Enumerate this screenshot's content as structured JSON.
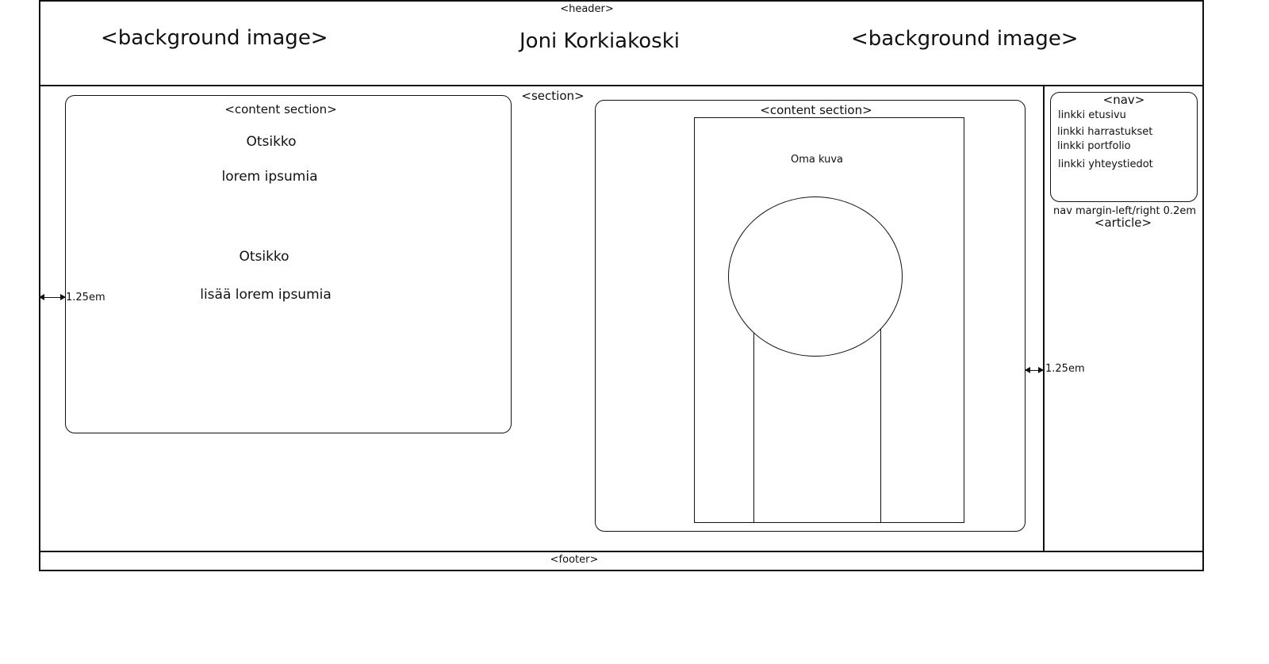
{
  "header": {
    "tag": "<header>",
    "title": "Joni Korkiakoski",
    "bg_left": "<background image>",
    "bg_right": "<background image>"
  },
  "section": {
    "tag": "<section>"
  },
  "content_left": {
    "tag": "<content section>",
    "heading1": "Otsikko",
    "text1": "lorem ipsumia",
    "heading2": "Otsikko",
    "text2": "lisää lorem ipsumia"
  },
  "content_right": {
    "tag": "<content section>",
    "image_label": "Oma kuva"
  },
  "nav": {
    "tag": "<nav>",
    "links": [
      "linkki etusivu",
      "linkki harrastukset",
      "linkki portfolio",
      "linkki yhteystiedot"
    ],
    "margin_note": "nav margin-left/right 0.2em"
  },
  "article": {
    "tag": "<article>"
  },
  "margins": {
    "left": "1.25em",
    "right": "1.25em"
  },
  "footer": {
    "tag": "<footer>"
  }
}
